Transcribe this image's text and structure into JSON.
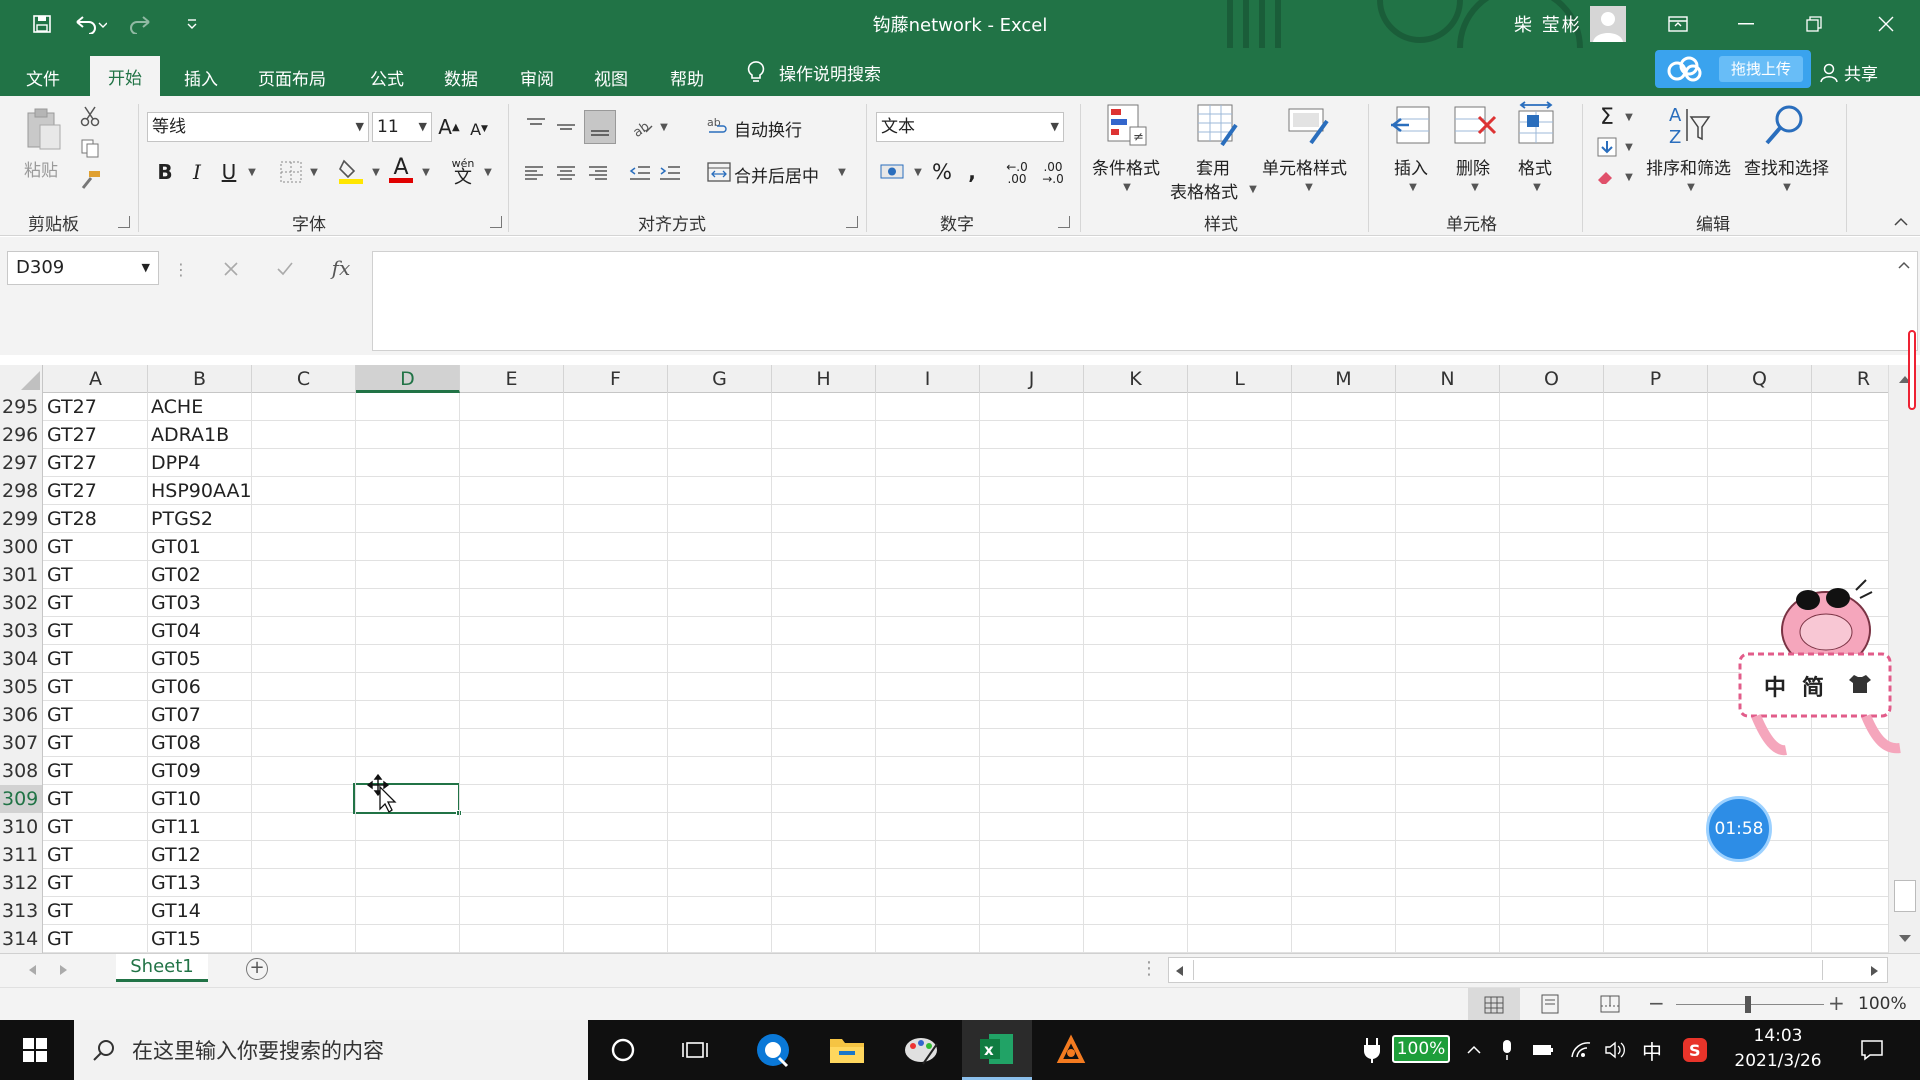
{
  "app": {
    "title": "钩藤network  -  Excel",
    "user_name": "柴 莹彬"
  },
  "tabs": [
    "文件",
    "开始",
    "插入",
    "页面布局",
    "公式",
    "数据",
    "审阅",
    "视图",
    "帮助"
  ],
  "active_tab": "开始",
  "tell_me": "操作说明搜索",
  "upload_label": "拖拽上传",
  "share_label": "共享",
  "ribbon": {
    "clipboard": {
      "paste": "粘贴",
      "label": "剪贴板"
    },
    "font": {
      "name": "等线",
      "size": "11",
      "label": "字体",
      "bold": "B",
      "italic": "I",
      "underline": "U"
    },
    "alignment": {
      "wrap": "自动换行",
      "merge": "合并后居中",
      "label": "对齐方式"
    },
    "number": {
      "format": "文本",
      "percent": "%",
      "label": "数字"
    },
    "styles": {
      "conditional": "条件格式",
      "table_1": "套用",
      "table_2": "表格格式",
      "cell_styles": "单元格样式",
      "label": "样式"
    },
    "cells": {
      "insert": "插入",
      "delete": "删除",
      "format": "格式",
      "label": "单元格"
    },
    "editing": {
      "sort": "排序和筛选",
      "find": "查找和选择",
      "label": "编辑"
    }
  },
  "formula_bar": {
    "name_box": "D309",
    "fx": "fx",
    "content": ""
  },
  "columns": [
    "A",
    "B",
    "C",
    "D",
    "E",
    "F",
    "G",
    "H",
    "I",
    "J",
    "K",
    "L",
    "M",
    "N",
    "O",
    "P",
    "Q",
    "R"
  ],
  "selected_column": "D",
  "rows": [
    {
      "n": "295",
      "a": "GT27",
      "b": "ACHE"
    },
    {
      "n": "296",
      "a": "GT27",
      "b": "ADRA1B"
    },
    {
      "n": "297",
      "a": "GT27",
      "b": "DPP4"
    },
    {
      "n": "298",
      "a": "GT27",
      "b": "HSP90AA1"
    },
    {
      "n": "299",
      "a": "GT28",
      "b": "PTGS2"
    },
    {
      "n": "300",
      "a": "GT",
      "b": "GT01"
    },
    {
      "n": "301",
      "a": "GT",
      "b": "GT02"
    },
    {
      "n": "302",
      "a": "GT",
      "b": "GT03"
    },
    {
      "n": "303",
      "a": "GT",
      "b": "GT04"
    },
    {
      "n": "304",
      "a": "GT",
      "b": "GT05"
    },
    {
      "n": "305",
      "a": "GT",
      "b": "GT06"
    },
    {
      "n": "306",
      "a": "GT",
      "b": "GT07"
    },
    {
      "n": "307",
      "a": "GT",
      "b": "GT08"
    },
    {
      "n": "308",
      "a": "GT",
      "b": "GT09"
    },
    {
      "n": "309",
      "a": "GT",
      "b": "GT10"
    },
    {
      "n": "310",
      "a": "GT",
      "b": "GT11"
    },
    {
      "n": "311",
      "a": "GT",
      "b": "GT12"
    },
    {
      "n": "312",
      "a": "GT",
      "b": "GT13"
    },
    {
      "n": "313",
      "a": "GT",
      "b": "GT14"
    },
    {
      "n": "314",
      "a": "GT",
      "b": "GT15"
    }
  ],
  "selected_row": "309",
  "sheet_tab": "Sheet1",
  "zoom": "100%",
  "timer": "01:58",
  "mascot_text": [
    "中",
    "简"
  ],
  "taskbar": {
    "search_placeholder": "在这里输入你要搜索的内容",
    "battery": "100%",
    "ime": "中",
    "time": "14:03",
    "date": "2021/3/26"
  },
  "colors": {
    "excel_green": "#217346",
    "accent_blue": "#2d8de6"
  }
}
